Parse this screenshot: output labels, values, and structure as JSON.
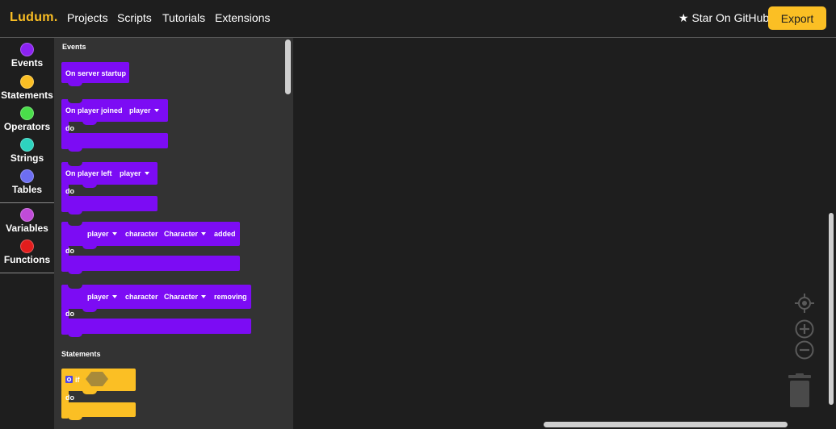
{
  "nav": {
    "logo": "Ludum.",
    "links": [
      "Projects",
      "Scripts",
      "Tutorials",
      "Extensions"
    ],
    "star": "★ Star On GitHub",
    "export": "Export"
  },
  "categories": [
    {
      "label": "Events",
      "color": "#8b22f2"
    },
    {
      "label": "Statements",
      "color": "#fbbf24"
    },
    {
      "label": "Operators",
      "color": "#4ade4a"
    },
    {
      "label": "Strings",
      "color": "#2dd4bf"
    },
    {
      "label": "Tables",
      "color": "#6d6ef2"
    },
    {
      "label": "Variables",
      "color": "#c04bd8"
    },
    {
      "label": "Functions",
      "color": "#e21d1d"
    }
  ],
  "flyout": {
    "sections": {
      "events": "Events",
      "statements": "Statements"
    },
    "blocks": {
      "server_startup": "On server startup",
      "player_joined": {
        "text": "On player joined",
        "dropdown": "player",
        "do": "do"
      },
      "player_left": {
        "text": "On player left",
        "dropdown": "player",
        "do": "do"
      },
      "char_added": {
        "player": "player",
        "character": "character",
        "dropdown": "Character",
        "suffix": "added",
        "do": "do"
      },
      "char_removing": {
        "player": "player",
        "character": "character",
        "dropdown": "Character",
        "suffix": "removing",
        "do": "do"
      },
      "if_block": {
        "if": "if",
        "do": "do"
      }
    }
  },
  "colors": {
    "accent": "#fbbf24",
    "event_block": "#7c0cf4",
    "statement_block": "#fbbf24"
  },
  "workspace_icons": [
    "target-icon",
    "zoom-in-icon",
    "zoom-out-icon",
    "trash-icon"
  ]
}
